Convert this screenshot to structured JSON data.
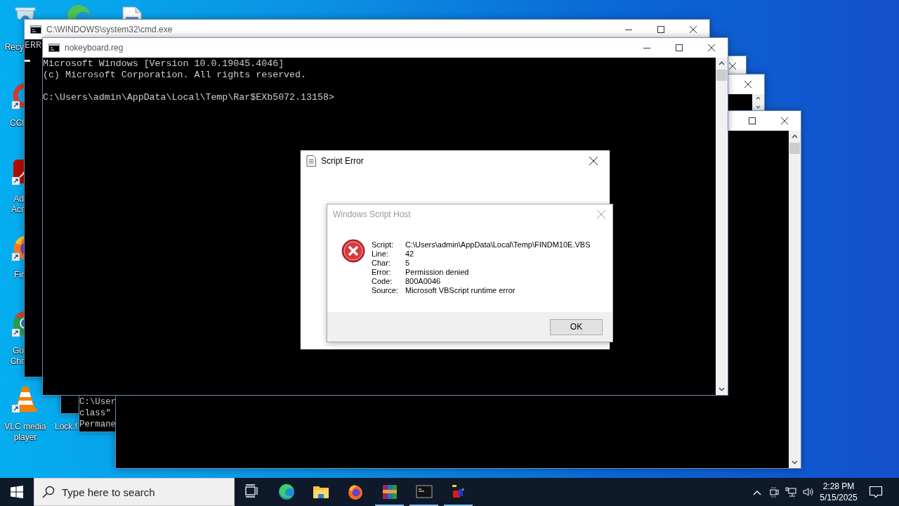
{
  "desktop_icons": [
    {
      "kind": "recycle-bin",
      "lines": [
        "Recy"
      ]
    },
    {
      "kind": "edge"
    },
    {
      "kind": "document"
    },
    {
      "kind": "cleaner",
      "lines": [
        "CCl"
      ],
      "shortcut": true
    },
    {
      "kind": "acrobat",
      "lines": [
        "Ad",
        "Acr"
      ],
      "shortcut": true
    },
    {
      "kind": "firefox",
      "lines": [
        "Fir"
      ],
      "shortcut": true
    },
    {
      "kind": "chrome",
      "lines": [
        "Go",
        "Chr"
      ],
      "shortcut": true
    },
    {
      "kind": "vlc",
      "lines": [
        "VLC media player"
      ],
      "shortcut": true
    },
    {
      "lines": [
        "Lock.f"
      ]
    }
  ],
  "windows": [
    {
      "title": "C:\\WINDOWS\\system32\\cmd.exe",
      "controls": [
        {
          "kind": "minimize"
        },
        {
          "kind": "maximize"
        },
        {
          "kind": "close"
        }
      ],
      "blocks": [
        [
          "ERR"
        ]
      ],
      "cursor": true
    },
    {
      "title": "nokeyboard.reg",
      "controls": [
        {
          "kind": "minimize"
        },
        {
          "kind": "maximize"
        },
        {
          "kind": "close"
        }
      ],
      "blocks": [
        [
          "Microsoft Windows [Version 10.0.19045.4046]",
          "(c) Microsoft Corporation. All rights reserved."
        ],
        [
          "C:\\Users\\admin\\AppData\\Local\\Temp\\Rar$EXb5072.13158>"
        ]
      ],
      "cursor": false
    },
    {
      "controls": [
        {
          "kind": "close"
        }
      ]
    },
    {
      "controls": [
        {
          "kind": "close"
        }
      ],
      "blocks": [
        [
          "C:\\User",
          "class\"",
          "Permane"
        ]
      ]
    },
    {
      "controls": [
        {
          "kind": "maximize"
        },
        {
          "kind": "close"
        }
      ]
    }
  ],
  "script_error": {
    "title": "Script Error"
  },
  "message_box": {
    "title": "Windows Script Host",
    "fields": [
      {
        "label": "Script:",
        "value": "C:\\Users\\admin\\AppData\\Local\\Temp\\FINDM10E.VBS"
      },
      {
        "label": "Line:",
        "value": "42"
      },
      {
        "label": "Char:",
        "value": "5"
      },
      {
        "label": "Error:",
        "value": "Permission denied"
      },
      {
        "label": "Code:",
        "value": "800A0046"
      },
      {
        "label": "Source:",
        "value": "Microsoft VBScript runtime error"
      }
    ],
    "buttons": [
      "OK"
    ]
  },
  "taskbar": {
    "search": {
      "placeholder": "Type here to search"
    },
    "apps": [
      {
        "kind": "task-view",
        "running": false
      },
      {
        "kind": "edge",
        "running": false
      },
      {
        "kind": "folder",
        "running": false
      },
      {
        "kind": "firefox",
        "running": false
      },
      {
        "kind": "archive",
        "running": true
      },
      {
        "kind": "console",
        "running": true
      },
      {
        "kind": "blocks",
        "running": true
      }
    ],
    "time": "2:28 PM",
    "date": "5/15/2025"
  }
}
